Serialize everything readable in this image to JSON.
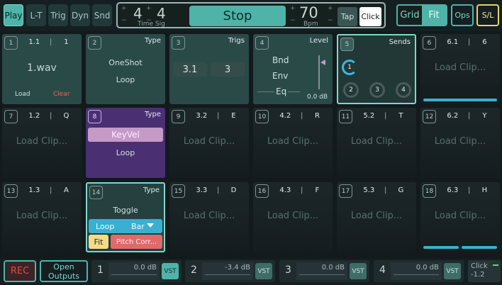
{
  "modes": [
    "Play",
    "L-T",
    "Trig",
    "Dyn",
    "Snd"
  ],
  "transport": {
    "ts_num": "4",
    "ts_den": "4",
    "ts_label": "Time Sig",
    "stop_label": "Stop",
    "bpm": "70",
    "bpm_label": "Bpm",
    "tap_label": "Tap",
    "click_label": "Click"
  },
  "view": {
    "grid_label": "Grid",
    "fit_label": "Fit",
    "ops_label": "Ops",
    "sl_label": "S/L"
  },
  "pads": {
    "p1": {
      "num": "1",
      "left": "1.1",
      "right": "1",
      "file": "1.wav",
      "load": "Load",
      "clear": "Clear"
    },
    "p2": {
      "num": "2",
      "title": "Type",
      "line1": "OneShot",
      "line2": "Loop"
    },
    "p3": {
      "num": "3",
      "title": "Trigs",
      "v1": "3.1",
      "v2": "3"
    },
    "p4": {
      "num": "4",
      "title": "Level",
      "bnd": "Bnd",
      "env": "Env",
      "eq": "Eq",
      "db": "0.0 dB"
    },
    "p5": {
      "num": "5",
      "title": "Sends",
      "k1": "1",
      "k2": "2",
      "k3": "3",
      "k4": "4"
    },
    "p6": {
      "num": "6",
      "left": "6.1",
      "right": "6",
      "load": "Load Clip..."
    },
    "p7": {
      "num": "7",
      "left": "1.2",
      "right": "Q",
      "load": "Load Clip..."
    },
    "p8": {
      "num": "8",
      "title": "Type",
      "line1": "KeyVel",
      "line2": "Loop"
    },
    "p9": {
      "num": "9",
      "left": "3.2",
      "right": "E",
      "load": "Load Clip..."
    },
    "p10": {
      "num": "10",
      "left": "4.2",
      "right": "R",
      "load": "Load Clip..."
    },
    "p11": {
      "num": "11",
      "left": "5.2",
      "right": "T",
      "load": "Load Clip..."
    },
    "p12": {
      "num": "12",
      "left": "6.2",
      "right": "Y",
      "load": "Load Clip..."
    },
    "p13": {
      "num": "13",
      "left": "1.3",
      "right": "A",
      "load": "Load Clip..."
    },
    "p14": {
      "num": "14",
      "title": "Type",
      "line1": "Toggle",
      "loop": "Loop",
      "bar": "Bar",
      "fit": "Fit",
      "pitch": "Pitch Corr..."
    },
    "p15": {
      "num": "15",
      "left": "3.3",
      "right": "D",
      "load": "Load Clip..."
    },
    "p16": {
      "num": "16",
      "left": "4.3",
      "right": "F",
      "load": "Load Clip..."
    },
    "p17": {
      "num": "17",
      "left": "5.3",
      "right": "G",
      "load": "Load Clip..."
    },
    "p18": {
      "num": "18",
      "left": "6.3",
      "right": "H",
      "load": "Load Clip..."
    }
  },
  "bottom": {
    "rec_label": "REC",
    "open_line1": "Open",
    "open_line2": "Outputs",
    "outputs": [
      {
        "num": "1",
        "db": "0.0 dB",
        "vst": "VST"
      },
      {
        "num": "2",
        "db": "-3.4 dB",
        "vst": "VST"
      },
      {
        "num": "3",
        "db": "0.0 dB",
        "vst": "VST"
      },
      {
        "num": "4",
        "db": "0.0 dB",
        "vst": "VST"
      }
    ],
    "click_label": "Click",
    "click_value": "-1.2"
  }
}
